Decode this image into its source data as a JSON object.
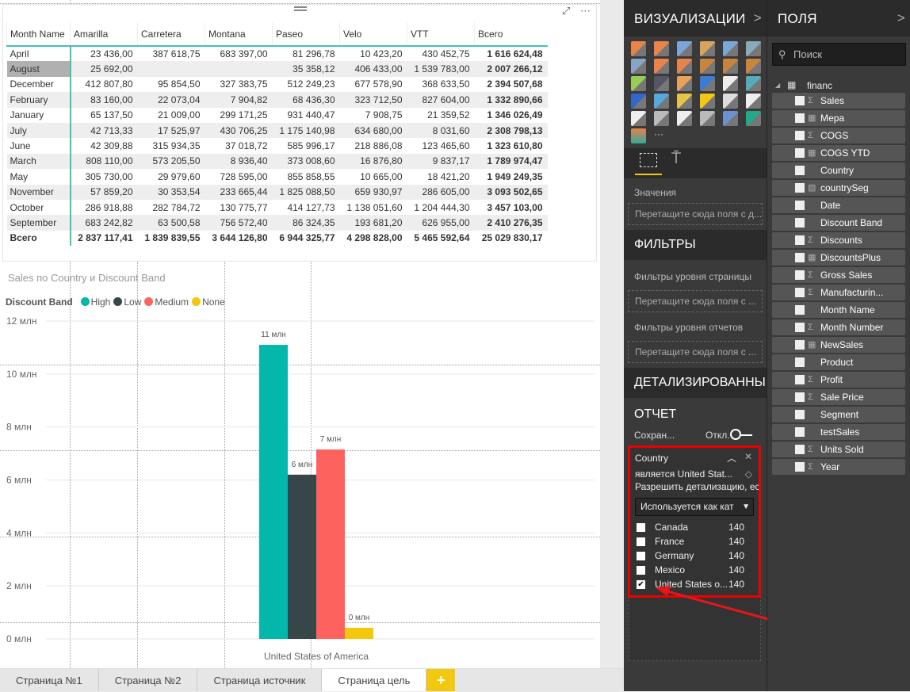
{
  "table": {
    "columns": [
      "Month Name",
      "Amarilla",
      "Carretera",
      "Montana",
      "Paseo",
      "Velo",
      "VTT",
      "Всего"
    ],
    "rows": [
      [
        "April",
        "23 436,00",
        "387 618,75",
        "683 397,00",
        "81 296,78",
        "10 423,20",
        "430 452,75",
        "1 616 624,48"
      ],
      [
        "August",
        "25 692,00",
        "",
        "",
        "35 358,12",
        "406 433,00",
        "1 539 783,00",
        "2 007 266,12"
      ],
      [
        "December",
        "412 807,80",
        "95 854,50",
        "327 383,75",
        "512 249,23",
        "677 578,90",
        "368 633,50",
        "2 394 507,68"
      ],
      [
        "February",
        "83 160,00",
        "22 073,04",
        "7 904,82",
        "68 436,30",
        "323 712,50",
        "827 604,00",
        "1 332 890,66"
      ],
      [
        "January",
        "65 137,50",
        "21 009,00",
        "299 171,25",
        "931 440,47",
        "7 908,75",
        "21 359,52",
        "1 346 026,49"
      ],
      [
        "July",
        "42 713,33",
        "17 525,97",
        "430 706,25",
        "1 175 140,98",
        "634 680,00",
        "8 031,60",
        "2 308 798,13"
      ],
      [
        "June",
        "42 309,88",
        "315 934,35",
        "37 018,72",
        "585 996,17",
        "218 886,08",
        "123 465,60",
        "1 323 610,80"
      ],
      [
        "March",
        "808 110,00",
        "573 205,50",
        "8 936,40",
        "373 008,60",
        "16 876,80",
        "9 837,17",
        "1 789 974,47"
      ],
      [
        "May",
        "305 730,00",
        "29 979,60",
        "728 595,00",
        "855 858,55",
        "10 665,00",
        "18 421,20",
        "1 949 249,35"
      ],
      [
        "November",
        "57 859,20",
        "30 353,54",
        "233 665,44",
        "1 825 088,50",
        "659 930,97",
        "286 605,00",
        "3 093 502,65"
      ],
      [
        "October",
        "286 918,88",
        "282 784,72",
        "130 775,77",
        "414 127,73",
        "1 138 051,60",
        "1 204 444,30",
        "3 457 103,00"
      ],
      [
        "September",
        "683 242,82",
        "63 500,58",
        "756 572,40",
        "86 324,35",
        "193 681,20",
        "626 955,00",
        "2 410 276,35"
      ]
    ],
    "total": [
      "Всего",
      "2 837 117,41",
      "1 839 839,55",
      "3 644 126,80",
      "6 944 325,77",
      "4 298 828,00",
      "5 465 592,64",
      "25 029 830,17"
    ],
    "selected_row": "August"
  },
  "chart_data": {
    "type": "bar",
    "title": "Sales по Country и Discount Band",
    "legend_title": "Discount Band",
    "legend_position": "top-left",
    "categories": [
      "United States of America"
    ],
    "series": [
      {
        "name": "High",
        "values": [
          11.1
        ],
        "color": "#01b8aa",
        "label": "11 млн"
      },
      {
        "name": "Low",
        "values": [
          6.2
        ],
        "color": "#374649",
        "label": "6 млн"
      },
      {
        "name": "Medium",
        "values": [
          7.15
        ],
        "color": "#fd625e",
        "label": "7 млн"
      },
      {
        "name": "None",
        "values": [
          0.42
        ],
        "color": "#f2c80f",
        "label": "0 млн"
      }
    ],
    "yticks": [
      "0 млн",
      "2 млн",
      "4 млн",
      "6 млн",
      "8 млн",
      "10 млн",
      "12 млн"
    ],
    "ylim": [
      0,
      12
    ],
    "grid": true
  },
  "pages": {
    "tabs": [
      "Страница №1",
      "Страница №2",
      "Страница источник",
      "Страница цель"
    ],
    "active": "Страница цель",
    "add": "+"
  },
  "viz": {
    "title": "ВИЗУАЛИЗАЦИИ",
    "chev": ">",
    "more": "···",
    "values_label": "Значения",
    "drop_values": "Перетащите сюда поля с д...",
    "filters_title": "ФИЛЬТРЫ",
    "page_filters": "Фильтры уровня страницы",
    "drop_page": "Перетащите сюда поля с ...",
    "report_filters": "Фильтры уровня отчетов",
    "drop_report": "Перетащите сюда поля с ...",
    "drill_title": "ДЕТАЛИЗИРОВАННЫ",
    "report_title": "ОТЧЕТ",
    "keep_label": "Сохран...",
    "toggle_label": "Откл.",
    "filter_card": {
      "field": "Country",
      "condition": "является United Stat...",
      "allow": "Разрешить детализацию, ес.",
      "mode": "Используется как кат",
      "items": [
        {
          "name": "Canada",
          "count": "140",
          "checked": false
        },
        {
          "name": "France",
          "count": "140",
          "checked": false
        },
        {
          "name": "Germany",
          "count": "140",
          "checked": false
        },
        {
          "name": "Mexico",
          "count": "140",
          "checked": false
        },
        {
          "name": "United States o...",
          "count": "140",
          "checked": true
        }
      ]
    }
  },
  "fields": {
    "title": "ПОЛЯ",
    "chev": ">",
    "search_placeholder": "Поиск",
    "table": "financ",
    "items": [
      {
        "name": "Sales",
        "type": "Σ"
      },
      {
        "name": "Мера",
        "type": "▦"
      },
      {
        "name": "COGS",
        "type": "Σ"
      },
      {
        "name": "COGS YTD",
        "type": "▦"
      },
      {
        "name": "Country",
        "type": ""
      },
      {
        "name": "countrySeg",
        "type": "▧"
      },
      {
        "name": "Date",
        "type": ""
      },
      {
        "name": "Discount Band",
        "type": ""
      },
      {
        "name": "Discounts",
        "type": "Σ"
      },
      {
        "name": "DiscountsPlus",
        "type": "▦"
      },
      {
        "name": "Gross Sales",
        "type": "Σ"
      },
      {
        "name": "Manufacturin...",
        "type": "Σ"
      },
      {
        "name": "Month Name",
        "type": ""
      },
      {
        "name": "Month Number",
        "type": "Σ"
      },
      {
        "name": "NewSales",
        "type": "▦"
      },
      {
        "name": "Product",
        "type": ""
      },
      {
        "name": "Profit",
        "type": "Σ"
      },
      {
        "name": "Sale Price",
        "type": "Σ"
      },
      {
        "name": "Segment",
        "type": ""
      },
      {
        "name": "testSales",
        "type": ""
      },
      {
        "name": "Units Sold",
        "type": "Σ"
      },
      {
        "name": "Year",
        "type": "Σ"
      }
    ]
  }
}
